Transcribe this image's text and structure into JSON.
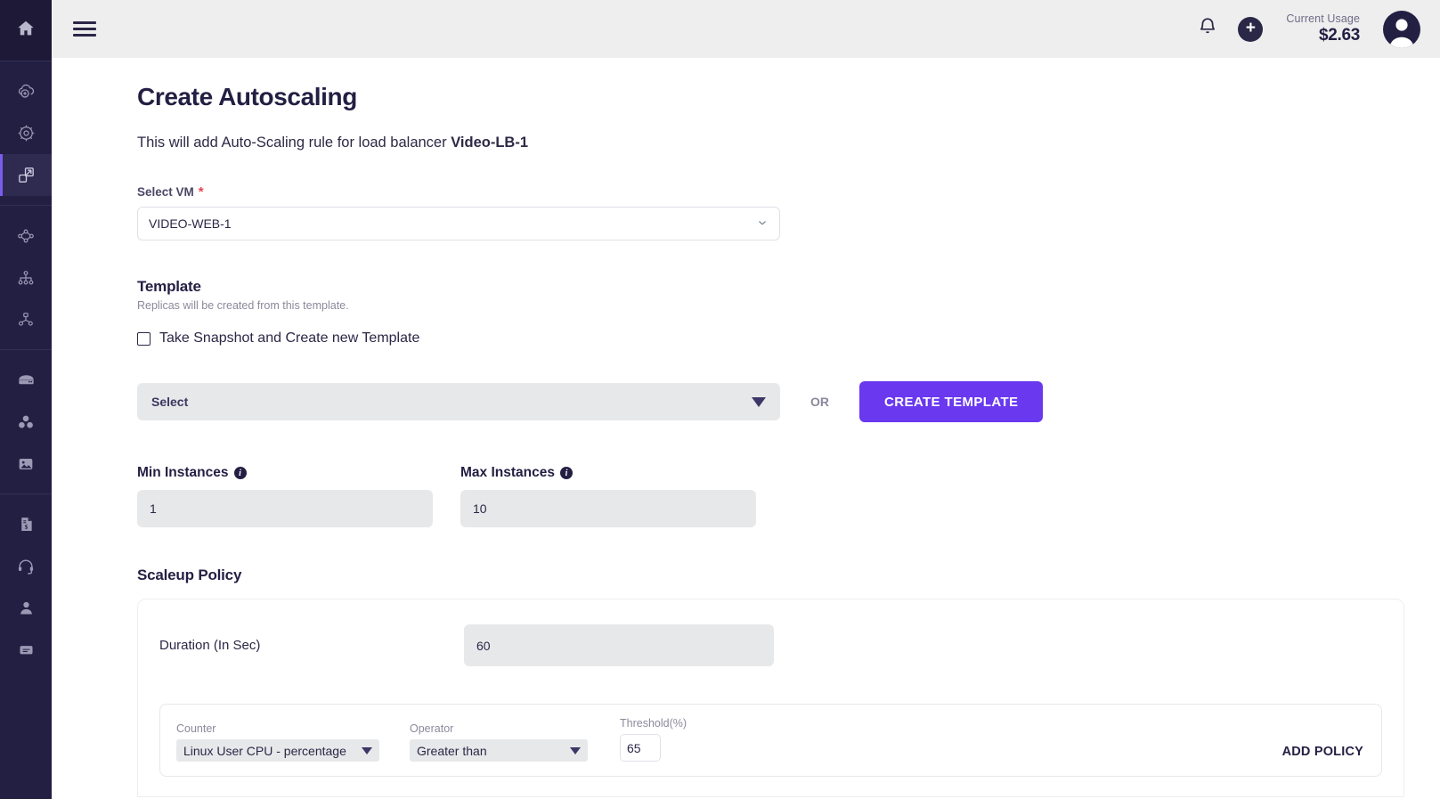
{
  "sidebar": {
    "groups": [
      {
        "items": [
          {
            "icon": "home-icon",
            "name": "sidebar-item-home",
            "active": false
          }
        ]
      },
      {
        "items": [
          {
            "icon": "cloud-plus-icon",
            "name": "sidebar-item-cloud",
            "active": false
          },
          {
            "icon": "kubernetes-helm-icon",
            "name": "sidebar-item-kubernetes",
            "active": false
          },
          {
            "icon": "autoscaling-expand-icon",
            "name": "sidebar-item-autoscaling",
            "active": true
          }
        ]
      },
      {
        "items": [
          {
            "icon": "network-topology-icon",
            "name": "sidebar-item-network",
            "active": false
          },
          {
            "icon": "load-balancer-icon",
            "name": "sidebar-item-load-balancer",
            "active": false
          },
          {
            "icon": "sitemap-icon",
            "name": "sidebar-item-sitemap",
            "active": false
          }
        ]
      },
      {
        "items": [
          {
            "icon": "storage-server-icon",
            "name": "sidebar-item-storage",
            "active": false
          },
          {
            "icon": "blocks-cubes-icon",
            "name": "sidebar-item-blocks",
            "active": false
          },
          {
            "icon": "image-icon",
            "name": "sidebar-item-images",
            "active": false
          }
        ]
      },
      {
        "items": [
          {
            "icon": "invoice-dollar-icon",
            "name": "sidebar-item-billing",
            "active": false
          },
          {
            "icon": "headset-support-icon",
            "name": "sidebar-item-support",
            "active": false
          },
          {
            "icon": "user-icon",
            "name": "sidebar-item-account",
            "active": false
          },
          {
            "icon": "card-document-icon",
            "name": "sidebar-item-docs",
            "active": false
          }
        ]
      }
    ]
  },
  "topbar": {
    "menu_icon": "hamburger-icon",
    "notification_icon": "bell-icon",
    "add_icon": "plus-icon",
    "usage_label": "Current Usage",
    "usage_amount": "$2.63",
    "avatar_icon": "user-avatar-icon"
  },
  "page": {
    "title": "Create Autoscaling",
    "subtitle_prefix": "This will add Auto-Scaling rule for load balancer ",
    "subtitle_strong": "Video-LB-1"
  },
  "select_vm": {
    "label": "Select VM",
    "required_marker": "*",
    "value": "VIDEO-WEB-1",
    "chevron_icon": "chevron-down-icon"
  },
  "template": {
    "title": "Template",
    "description": "Replicas will be created from this template.",
    "checkbox_label": "Take Snapshot and Create new Template",
    "checkbox_checked": false,
    "select_placeholder": "Select",
    "or_text": "OR",
    "create_button": "CREATE TEMPLATE"
  },
  "instances": {
    "min_label": "Min Instances",
    "min_value": "1",
    "max_label": "Max Instances",
    "max_value": "10",
    "info_icon": "info-icon",
    "info_glyph": "i"
  },
  "scaleup": {
    "title": "Scaleup Policy",
    "duration_label": "Duration (In Sec)",
    "duration_value": "60",
    "policy": {
      "counter_label": "Counter",
      "counter_value": "Linux User CPU - percentage",
      "operator_label": "Operator",
      "operator_value": "Greater than",
      "threshold_label": "Threshold(%)",
      "threshold_value": "65",
      "add_policy_label": "ADD POLICY"
    }
  },
  "colors": {
    "sidebar_bg": "#231f43",
    "accent_purple": "#6938ef",
    "active_bar": "#7b5cf0",
    "topbar_bg": "#eeeeee",
    "input_grey": "#e7e8ea",
    "required_red": "#e8434f",
    "heading": "#231f43"
  }
}
